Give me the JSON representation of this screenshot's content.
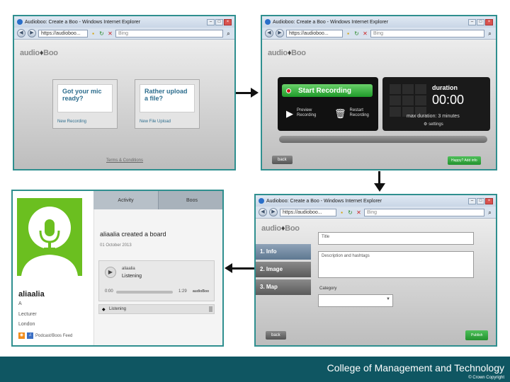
{
  "panels": {
    "p1": {
      "window_title": "Audioboo: Create a Boo - Windows Internet Explorer",
      "url": "https://audioboo...",
      "search": "Bing",
      "logo": {
        "pre": "audio",
        "post": "Boo"
      },
      "cards": [
        {
          "heading": "Got your mic ready?",
          "link": "New Recording"
        },
        {
          "heading": "Rather upload a file?",
          "link": "New File Upload"
        }
      ],
      "terms_link": "Terms & Conditions"
    },
    "p2": {
      "window_title": "Audioboo: Create a Boo - Windows Internet Explorer",
      "url": "https://audioboo...",
      "search": "Bing",
      "logo": {
        "pre": "audio",
        "post": "Boo"
      },
      "start_recording": "Start Recording",
      "preview": "Preview Recording",
      "restart": "Restart Recording",
      "duration_label": "duration",
      "duration_value": "00:00",
      "max_duration": "max duration: 3 minutes",
      "settings": "settings",
      "back": "back",
      "next": "Happy? Add info"
    },
    "p3": {
      "window_title": "Audioboo: Create a Boo - Windows Internet Explorer",
      "url": "https://audioboo...",
      "search": "Bing",
      "logo": {
        "pre": "audio",
        "post": "Boo"
      },
      "nav": [
        "1. Info",
        "2. Image",
        "3. Map"
      ],
      "title_placeholder": "Title",
      "description": "Description and hashtags",
      "category_label": "Category",
      "back": "back",
      "publish": "Publish"
    },
    "p4": {
      "tabs": [
        "Activity",
        "Boos"
      ],
      "username": "aliaalia",
      "initial": "A",
      "role": "Lecturer",
      "location": "London",
      "feed_link": "Podcast/Boos Feed",
      "activity_heading": "aliaalia created a board",
      "activity_date": "01 October 2013",
      "player_user": "aliaalia",
      "player_title": "Listening",
      "time_start": "0:00",
      "time_end": "1:29",
      "brand": "audioBoo",
      "comment": "Listening"
    }
  },
  "footer": {
    "title": "College of Management and Technology",
    "copyright": "© Crown Copyright"
  },
  "colors": {
    "accent": "#2f8f8f",
    "footer": "#0f5662",
    "avatar_bg": "#6bbf20"
  }
}
